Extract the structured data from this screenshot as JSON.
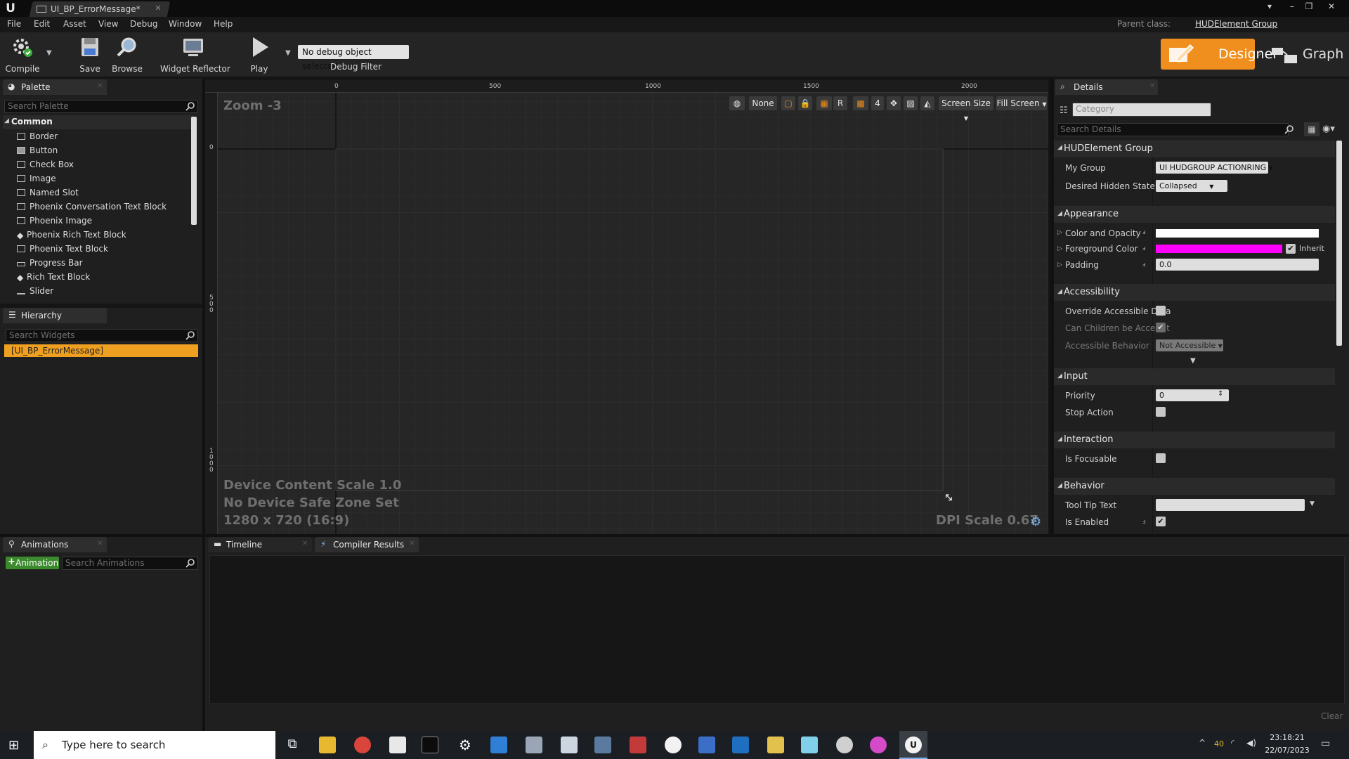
{
  "window": {
    "tab_title": "UI_BP_ErrorMessage*",
    "parent_class_label": "Parent class:",
    "parent_class_value": "HUDElement Group"
  },
  "menu": [
    "File",
    "Edit",
    "Asset",
    "View",
    "Debug",
    "Window",
    "Help"
  ],
  "toolbar": {
    "compile": "Compile",
    "save": "Save",
    "browse": "Browse",
    "widget_reflector": "Widget Reflector",
    "play": "Play",
    "debug_select": "No debug object selected",
    "debug_filter": "Debug Filter",
    "designer": "Designer",
    "graph": "Graph"
  },
  "palette": {
    "tab": "Palette",
    "search_placeholder": "Search Palette",
    "category": "Common",
    "items": [
      "Border",
      "Button",
      "Check Box",
      "Image",
      "Named Slot",
      "Phoenix Conversation Text Block",
      "Phoenix Image",
      "Phoenix Rich Text Block",
      "Phoenix Text Block",
      "Progress Bar",
      "Rich Text Block",
      "Slider"
    ]
  },
  "hierarchy": {
    "tab": "Hierarchy",
    "search_placeholder": "Search Widgets",
    "root": "[UI_BP_ErrorMessage]"
  },
  "viewport": {
    "zoom": "Zoom -3",
    "ruler_top": [
      "0",
      "500",
      "1000",
      "1500",
      "2000"
    ],
    "ruler_left": [
      "0",
      "5\n0\n0",
      "1\n0\n0\n0"
    ],
    "toolbar": {
      "none": "None",
      "r": "R",
      "grid_num": "4",
      "screen_size": "Screen Size",
      "fill_screen": "Fill Screen"
    },
    "device_scale": "Device Content Scale 1.0",
    "safe_zone": "No Device Safe Zone Set",
    "resolution": "1280 x 720 (16:9)",
    "dpi": "DPI Scale 0.67"
  },
  "details": {
    "tab": "Details",
    "category_placeholder": "Category",
    "search_placeholder": "Search Details",
    "sections": {
      "hud": "HUDElement Group",
      "appearance": "Appearance",
      "accessibility": "Accessibility",
      "input": "Input",
      "interaction": "Interaction",
      "behavior": "Behavior"
    },
    "props": {
      "my_group": "My Group",
      "my_group_value": "UI HUDGROUP ACTIONRING",
      "desired_hidden_state": "Desired Hidden State",
      "desired_hidden_state_value": "Collapsed",
      "color_opacity": "Color and Opacity",
      "foreground_color": "Foreground Color",
      "inherit": "Inherit",
      "padding": "Padding",
      "padding_value": "0.0",
      "override_accessible": "Override Accessible Defa",
      "can_children": "Can Children be Accessit",
      "accessible_behavior": "Accessible Behavior",
      "accessible_behavior_value": "Not Accessible",
      "priority": "Priority",
      "priority_value": "0",
      "stop_action": "Stop Action",
      "is_focusable": "Is Focusable",
      "tool_tip_text": "Tool Tip Text",
      "is_enabled": "Is Enabled"
    },
    "colors": {
      "color_opacity": "#ffffff",
      "foreground": "#ff00ff"
    }
  },
  "bottom": {
    "animations_tab": "Animations",
    "add_animation": "Animation",
    "search_animations": "Search Animations",
    "timeline_tab": "Timeline",
    "compiler_tab": "Compiler Results",
    "clear": "Clear"
  },
  "taskbar": {
    "search_placeholder": "Type here to search",
    "temp": "40",
    "time": "23:18:21",
    "date": "22/07/2023"
  }
}
